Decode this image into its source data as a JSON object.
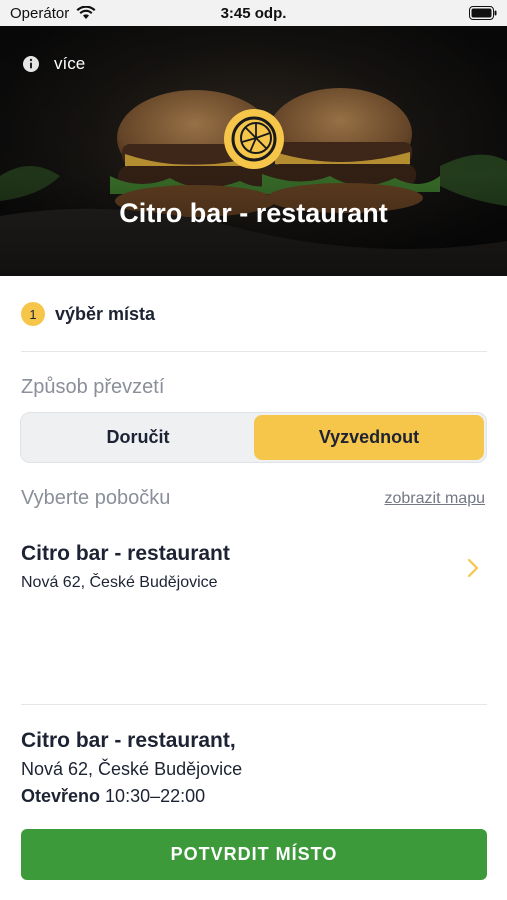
{
  "status_bar": {
    "carrier": "Operátor",
    "time": "3:45 odp."
  },
  "header": {
    "more_label": "více",
    "restaurant_title": "Citro bar - restaurant",
    "logo_color": "#f6c64b"
  },
  "step": {
    "number": "1",
    "label": "výběr místa"
  },
  "delivery": {
    "section_label": "Způsob převzetí",
    "options": [
      "Doručit",
      "Vyzvednout"
    ],
    "selected": "Vyzvednout",
    "selected_color": "#f6c64b"
  },
  "branch_select": {
    "section_label": "Vyberte pobočku",
    "map_link": "zobrazit mapu",
    "branches": [
      {
        "name": "Citro bar - restaurant",
        "address": "Nová 62, České Budějovice"
      }
    ]
  },
  "summary": {
    "name": "Citro bar - restaurant,",
    "address": "Nová 62, České Budějovice",
    "open_label": "Otevřeno",
    "hours": "10:30–22:00"
  },
  "confirm_button": {
    "label": "POTVRDIT MÍSTO",
    "color": "#3d9a3a"
  }
}
